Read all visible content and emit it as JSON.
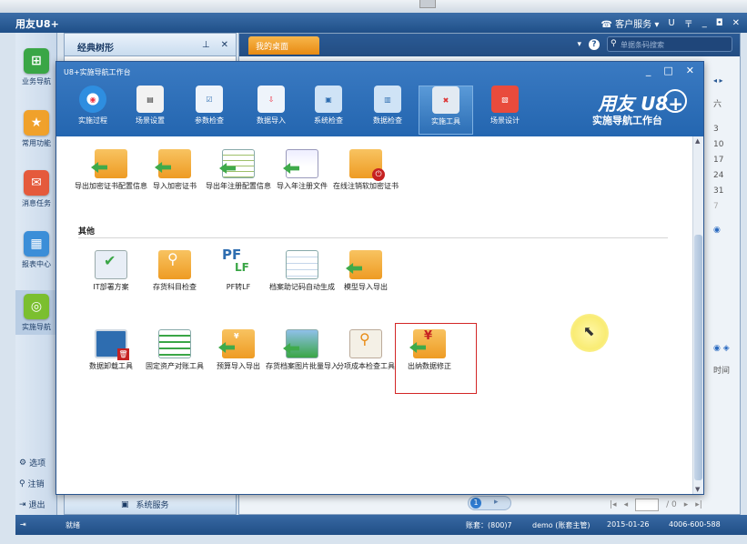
{
  "app": {
    "logo": "用友U8+",
    "service_label": "客户服务",
    "u_label": "U",
    "menu_glyph": "〒",
    "min_glyph": "_",
    "restore_glyph": "◘",
    "close_glyph": "✕"
  },
  "sidebar": {
    "items": [
      {
        "label": "业务导航",
        "color": "#3aa646",
        "glyph": "⊞"
      },
      {
        "label": "常用功能",
        "color": "#f0a12b",
        "glyph": "★"
      },
      {
        "label": "消息任务",
        "color": "#e55a3c",
        "glyph": "✉"
      },
      {
        "label": "报表中心",
        "color": "#3b8ed8",
        "glyph": "▦"
      },
      {
        "label": "实施导航",
        "color": "#7bbf2f",
        "glyph": "◎"
      }
    ],
    "footer": [
      {
        "label": "选项",
        "icon": "⚙"
      },
      {
        "label": "注销",
        "icon": "⚲"
      },
      {
        "label": "退出",
        "icon": "⇥"
      }
    ]
  },
  "tree_panel": {
    "title": "经典树形",
    "pin_glyph": "⊥",
    "close_glyph": "✕",
    "footer_label": "系统服务"
  },
  "main": {
    "tab_label": "我的桌面",
    "search_placeholder": "单据条码搜索",
    "help_glyph": "?",
    "nav_arrows": "◂ ▸",
    "calendar_header": "六",
    "calendar_days": [
      "3",
      "10",
      "17",
      "24",
      "31",
      "7"
    ],
    "time_label": "时间",
    "pager": {
      "page": "/ 0",
      "first": "|◂",
      "prev": "◂",
      "next": "▸",
      "last": "▸|"
    }
  },
  "dialog": {
    "title": "U8+实施导航工作台",
    "min_glyph": "_",
    "max_glyph": "□",
    "close_glyph": "✕",
    "brand": "用友 U8+",
    "brand_sub": "实施导航工作台",
    "tools": [
      {
        "label": "实施过程",
        "glyph": "◉",
        "color": "#2e8ee0"
      },
      {
        "label": "场景设置",
        "glyph": "▤",
        "color": "#f2f2f2"
      },
      {
        "label": "参数检查",
        "glyph": "☑",
        "color": "#eef4fb"
      },
      {
        "label": "数据导入",
        "glyph": "⇩",
        "color": "#eef4fb"
      },
      {
        "label": "系统检查",
        "glyph": "▣",
        "color": "#cfe3f6"
      },
      {
        "label": "数据检查",
        "glyph": "▥",
        "color": "#cfe3f6"
      },
      {
        "label": "实施工具",
        "glyph": "✖",
        "color": "#e2eaf2"
      },
      {
        "label": "场景设计",
        "glyph": "▧",
        "color": "#e94b3c"
      }
    ],
    "active_tool_index": 6,
    "rows": {
      "row1": [
        {
          "label": "导出加密证书配置信息"
        },
        {
          "label": "导入加密证书"
        },
        {
          "label": "导出年注册配置信息"
        },
        {
          "label": "导入年注册文件"
        },
        {
          "label": "在线注销软加密证书"
        }
      ],
      "section": "其他",
      "row2": [
        {
          "label": "IT部署方案"
        },
        {
          "label": "存货科目检查"
        },
        {
          "label": "PF转LF"
        },
        {
          "label": "档案助记码自动生成"
        },
        {
          "label": "模型导入导出"
        }
      ],
      "row3": [
        {
          "label": "数据卸载工具"
        },
        {
          "label": "固定资产对账工具"
        },
        {
          "label": "预算导入导出"
        },
        {
          "label": "存货档案图片批量导入"
        },
        {
          "label": "分项成本检查工具"
        },
        {
          "label": "出纳数据修正"
        }
      ]
    }
  },
  "statusbar": {
    "ready": "就绪",
    "account": "账套：(800)7",
    "user": "demo (账套主管)",
    "date": "2015-01-26",
    "phone": "4006-600-588"
  }
}
